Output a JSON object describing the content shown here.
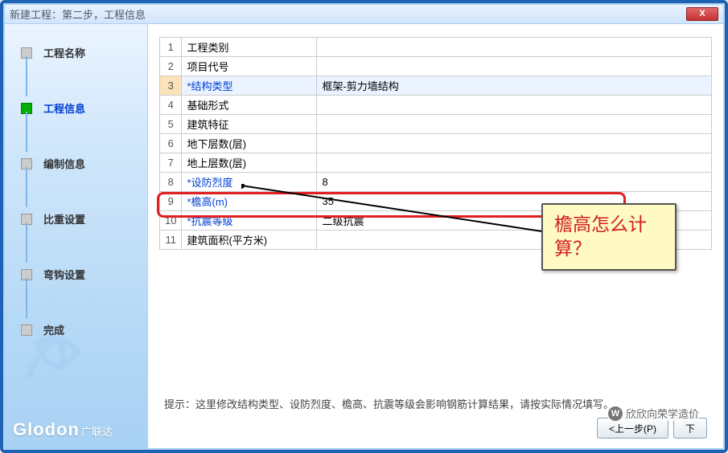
{
  "window": {
    "title": "新建工程：第二步，工程信息",
    "close_symbol": "X"
  },
  "sidebar": {
    "steps": [
      {
        "label": "工程名称",
        "active": false
      },
      {
        "label": "工程信息",
        "active": true
      },
      {
        "label": "编制信息",
        "active": false
      },
      {
        "label": "比重设置",
        "active": false
      },
      {
        "label": "弯钩设置",
        "active": false
      },
      {
        "label": "完成",
        "active": false
      }
    ],
    "brand": "Glodon",
    "brand_cn": "广联达"
  },
  "grid": {
    "rows": [
      {
        "num": "1",
        "name": "工程类别",
        "val": "",
        "blue": false,
        "hl": false
      },
      {
        "num": "2",
        "name": "项目代号",
        "val": "",
        "blue": false,
        "hl": false
      },
      {
        "num": "3",
        "name": "*结构类型",
        "val": "框架-剪力墙结构",
        "blue": true,
        "hl": true
      },
      {
        "num": "4",
        "name": "基础形式",
        "val": "",
        "blue": false,
        "hl": false
      },
      {
        "num": "5",
        "name": "建筑特征",
        "val": "",
        "blue": false,
        "hl": false
      },
      {
        "num": "6",
        "name": "地下层数(层)",
        "val": "",
        "blue": false,
        "hl": false
      },
      {
        "num": "7",
        "name": "地上层数(层)",
        "val": "",
        "blue": false,
        "hl": false
      },
      {
        "num": "8",
        "name": "*设防烈度",
        "val": "8",
        "blue": true,
        "hl": false
      },
      {
        "num": "9",
        "name": "*檐高(m)",
        "val": "35",
        "blue": true,
        "hl": false
      },
      {
        "num": "10",
        "name": "*抗震等级",
        "val": "二级抗震",
        "blue": true,
        "hl": false
      },
      {
        "num": "11",
        "name": "建筑面积(平方米)",
        "val": "",
        "blue": false,
        "hl": false
      }
    ]
  },
  "hint": "提示：这里修改结构类型、设防烈度、檐高、抗震等级会影响钢筋计算结果，请按实际情况填写。",
  "buttons": {
    "prev": "<上一步(P)",
    "next": "下"
  },
  "callout_text": "檐高怎么计算？",
  "watermark": "欣欣向荣学造价"
}
